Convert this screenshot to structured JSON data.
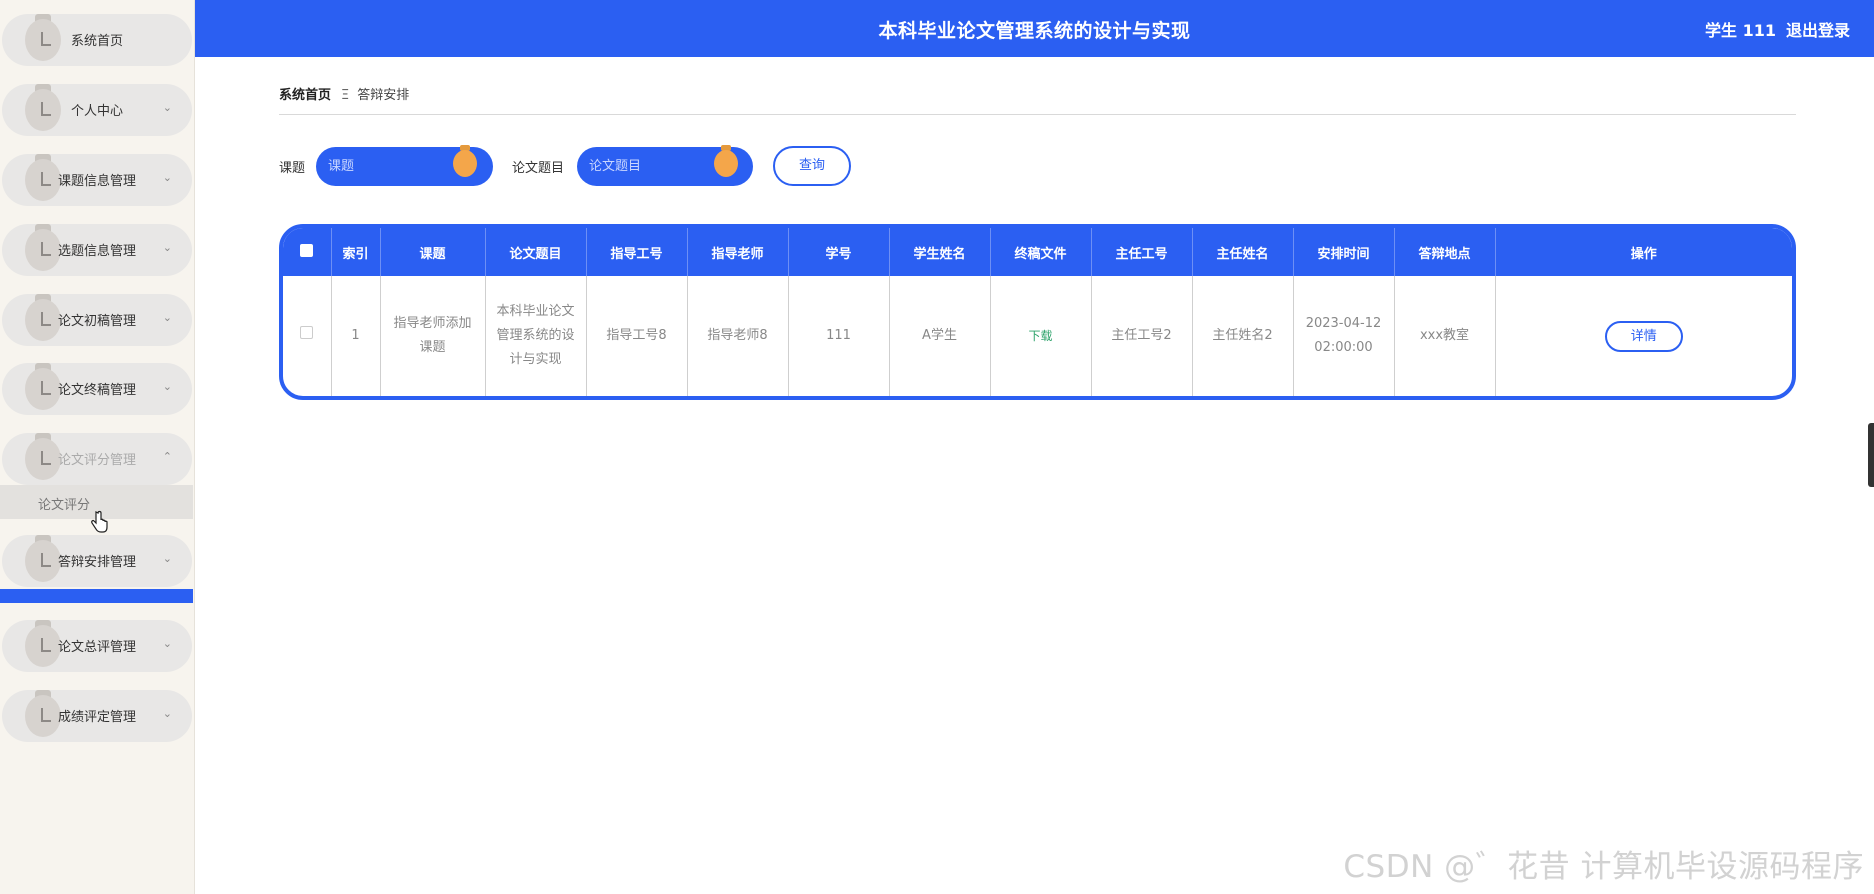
{
  "header": {
    "title": "本科毕业论文管理系统的设计与实现",
    "user": "学生 111",
    "logout": "退出登录"
  },
  "sidebar": {
    "items": [
      {
        "label": "系统首页",
        "expandable": false,
        "dim": false
      },
      {
        "label": "个人中心",
        "expandable": true,
        "dim": false
      },
      {
        "label": "课题信息管理",
        "expandable": true,
        "dim": false
      },
      {
        "label": "选题信息管理",
        "expandable": true,
        "dim": false
      },
      {
        "label": "论文初稿管理",
        "expandable": true,
        "dim": false
      },
      {
        "label": "论文终稿管理",
        "expandable": true,
        "dim": false
      },
      {
        "label": "论文评分管理",
        "expandable": true,
        "dim": true,
        "expanded": true
      },
      {
        "label": "答辩安排管理",
        "expandable": true,
        "dim": false
      },
      {
        "label": "论文总评管理",
        "expandable": true,
        "dim": false
      },
      {
        "label": "成绩评定管理",
        "expandable": true,
        "dim": false
      }
    ],
    "submenu_item": "论文评分"
  },
  "breadcrumb": {
    "home": "系统首页",
    "separator": "Ξ",
    "current": "答辩安排"
  },
  "search": {
    "field1_label": "课题",
    "field1_placeholder": "课题",
    "field2_label": "论文题目",
    "field2_placeholder": "论文题目",
    "query_button": "查询"
  },
  "table": {
    "headers": [
      "",
      "索引",
      "课题",
      "论文题目",
      "指导工号",
      "指导老师",
      "学号",
      "学生姓名",
      "终稿文件",
      "主任工号",
      "主任姓名",
      "安排时间",
      "答辩地点",
      "操作"
    ],
    "rows": [
      {
        "index": "1",
        "topic": "指导老师添加课题",
        "paper_title": "本科毕业论文管理系统的设计与实现",
        "advisor_id": "指导工号8",
        "advisor_name": "指导老师8",
        "student_id": "111",
        "student_name": "A学生",
        "final_file": "下载",
        "director_id": "主任工号2",
        "director_name": "主任姓名2",
        "time": "2023-04-12 02:00:00",
        "location": "xxx教室",
        "action": "详情"
      }
    ]
  },
  "watermark": "CSDN @゛花昔 计算机毕设源码程序",
  "colors": {
    "primary": "#2b5ff2",
    "knob": "#f4a64a",
    "sidebar_bg": "#f7f4ee",
    "download": "#2ea36b"
  }
}
